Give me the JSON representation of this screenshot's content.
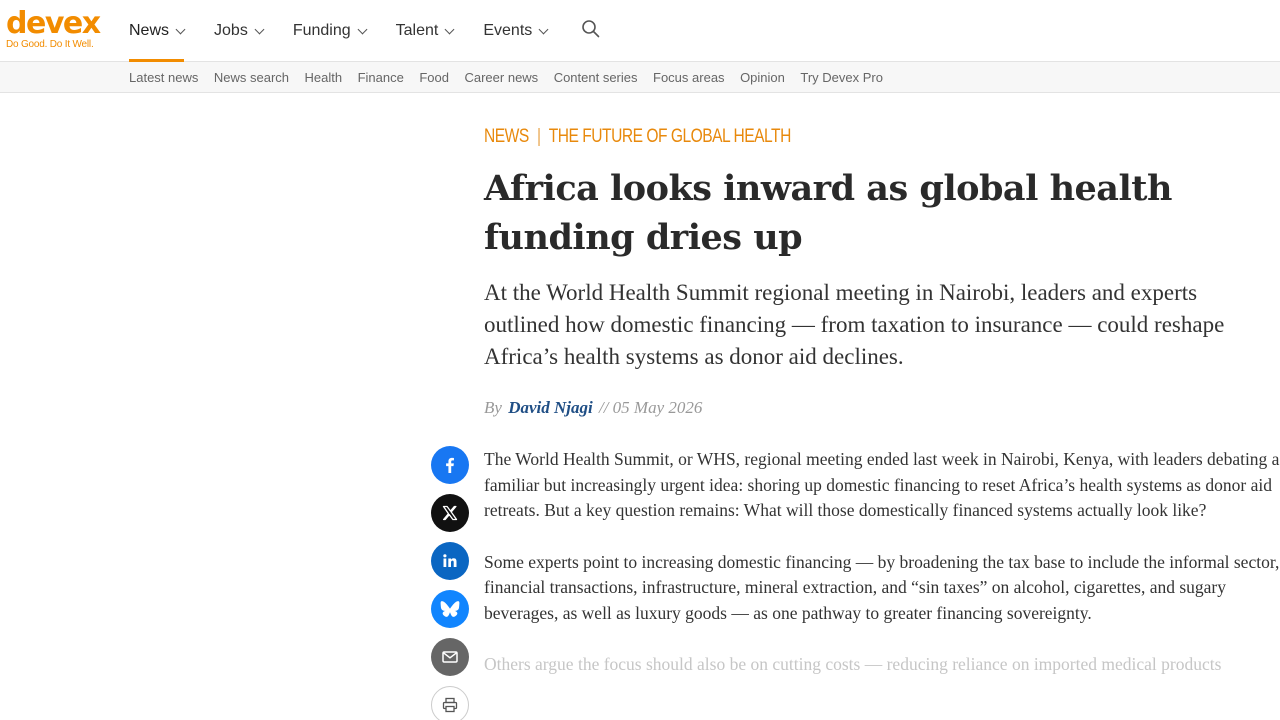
{
  "brand": {
    "name": "devex",
    "tagline": "Do Good. Do It Well.",
    "color": "#f28c00"
  },
  "main_nav": [
    {
      "label": "News",
      "active": true
    },
    {
      "label": "Jobs"
    },
    {
      "label": "Funding"
    },
    {
      "label": "Talent"
    },
    {
      "label": "Events"
    }
  ],
  "search": {
    "icon": "search-icon"
  },
  "sub_nav": [
    "Latest news",
    "News search",
    "Health",
    "Finance",
    "Food",
    "Career news",
    "Content series",
    "Focus areas",
    "Opinion",
    "Try Devex Pro"
  ],
  "article": {
    "section": "NEWS",
    "series": "THE FUTURE OF GLOBAL HEALTH",
    "headline": "Africa looks inward as global health funding dries up",
    "dek": "At the World Health Summit regional meeting in Nairobi, leaders and experts outlined how domestic financing — from taxation to insurance — could reshape Africa’s health systems as donor aid declines.",
    "byline_prefix": "By",
    "author": "David Njagi",
    "date_sep": "//",
    "date": "05 May 2026",
    "paragraphs": [
      "The World Health Summit, or WHS, regional meeting ended last week in Nairobi, Kenya, with leaders debating a familiar but increasingly urgent idea: shoring up domestic financing to reset Africa’s health systems as donor aid retreats. But a key question remains: What will those domestically financed systems actually look like?",
      "Some experts point to increasing domestic financing — by broadening the tax base to include the informal sector, financial transactions, infrastructure, mineral extraction, and “sin taxes” on alcohol, cigarettes, and sugary beverages, as well as luxury goods — as one pathway to greater financing sovereignty.",
      "Others argue the focus should also be on cutting costs — reducing reliance on imported medical products"
    ]
  },
  "share": [
    {
      "icon": "facebook-icon",
      "color": "#1877f2"
    },
    {
      "icon": "x-icon",
      "color": "#111111"
    },
    {
      "icon": "linkedin-icon",
      "color": "#0a66c2"
    },
    {
      "icon": "bluesky-icon",
      "color": "#1185fe"
    },
    {
      "icon": "email-icon",
      "color": "#666666"
    },
    {
      "icon": "print-icon",
      "color": "#ffffff"
    }
  ]
}
